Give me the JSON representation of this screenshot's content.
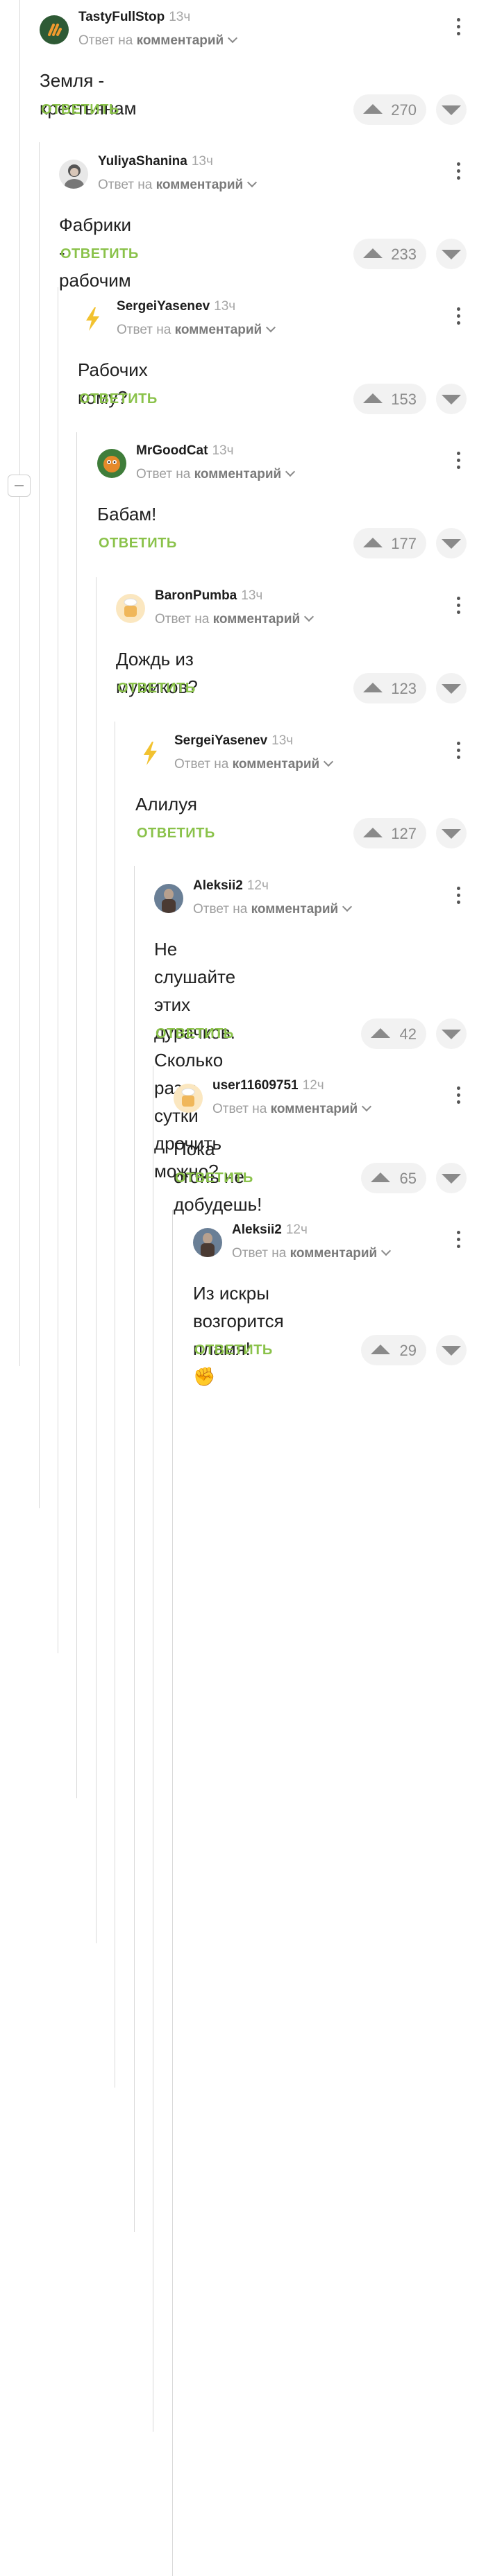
{
  "labels": {
    "reply_to_prefix": "Ответ на",
    "reply_to_link": "комментарий",
    "reply_button": "ОТВЕТИТЬ"
  },
  "icons": {
    "thread_collapse": "minus-icon",
    "menu": "more-vertical-icon",
    "upvote": "triangle-up-icon",
    "downvote": "triangle-down-icon"
  },
  "colors": {
    "accent": "#8ac24a",
    "muted": "#9d9d9d",
    "pill": "#f2f2f2"
  },
  "comments": [
    {
      "author": "TastyFullStop",
      "time": "13ч",
      "text": [
        "Земля - крестьянам"
      ],
      "score": "270"
    },
    {
      "author": "YuliyaShanina",
      "time": "13ч",
      "text": [
        "Фабрики - рабочим"
      ],
      "score": "233"
    },
    {
      "author": "SergeiYasenev",
      "time": "13ч",
      "text": [
        "Рабочих кому?"
      ],
      "score": "153"
    },
    {
      "author": "MrGoodCat",
      "time": "13ч",
      "text": [
        "Бабам!"
      ],
      "score": "177"
    },
    {
      "author": "BaronPumba",
      "time": "13ч",
      "text": [
        "Дождь из мужиков?"
      ],
      "score": "123"
    },
    {
      "author": "SergeiYasenev",
      "time": "13ч",
      "text": [
        "Алилуя"
      ],
      "score": "127"
    },
    {
      "author": "Aleksii2",
      "time": "12ч",
      "text": [
        "Не слушайте этих дурачков.",
        "Сколько раз в сутки дрочить",
        "можно?"
      ],
      "score": "42"
    },
    {
      "author": "user11609751",
      "time": "12ч",
      "text": [
        "Пока огонь не добудешь!"
      ],
      "score": "65"
    },
    {
      "author": "Aleksii2",
      "time": "12ч",
      "text": [
        "Из искры возгорится пламя!",
        "✊"
      ],
      "score": "29"
    }
  ]
}
